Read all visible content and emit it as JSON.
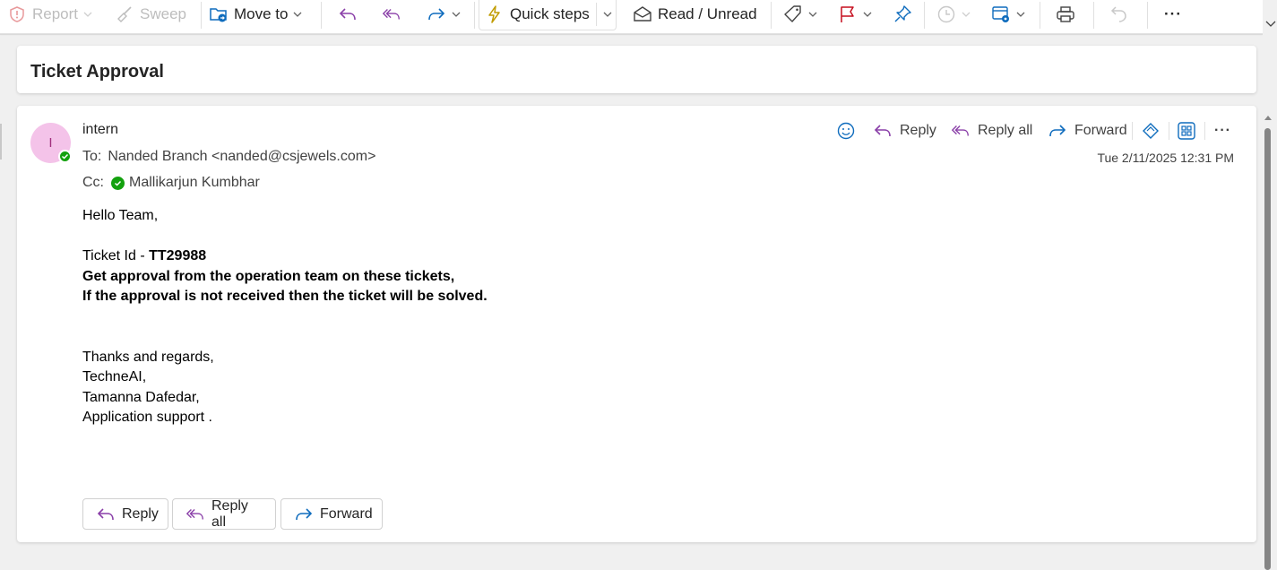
{
  "toolbar": {
    "report_label": "Report",
    "sweep_label": "Sweep",
    "move_to_label": "Move to",
    "quick_steps_label": "Quick steps",
    "read_unread_label": "Read / Unread",
    "more_label": "···"
  },
  "subject": "Ticket Approval",
  "message": {
    "avatar_initial": "I",
    "sender": "intern",
    "to_prefix": "To:",
    "to_value": "Nanded Branch <nanded@csjewels.com>",
    "cc_prefix": "Cc:",
    "cc_value": "Mallikarjun Kumbhar",
    "timestamp": "Tue 2/11/2025 12:31 PM",
    "actions": {
      "reply": "Reply",
      "reply_all": "Reply all",
      "forward": "Forward",
      "more": "···"
    },
    "body": {
      "greeting": "Hello Team,",
      "ticket_prefix": "Ticket Id - ",
      "ticket_id": "TT29988",
      "line1": "Get approval from the operation team on these tickets,",
      "line2": "If the approval is not received then the ticket will be solved.",
      "sig1": "Thanks and regards,",
      "sig2": "TechneAI,",
      "sig3": "Tamanna Dafedar,",
      "sig4": "Application support ."
    },
    "footer": {
      "reply": "Reply",
      "reply_all": "Reply all",
      "forward": "Forward"
    }
  },
  "colors": {
    "reply_icon": "#8a3fa8",
    "forward_icon": "#0f6cbd",
    "flag": "#c50f1f",
    "avatar_bg": "#f4c3e9",
    "presence": "#13a10e",
    "quick_steps_icon": "#c19c00"
  }
}
